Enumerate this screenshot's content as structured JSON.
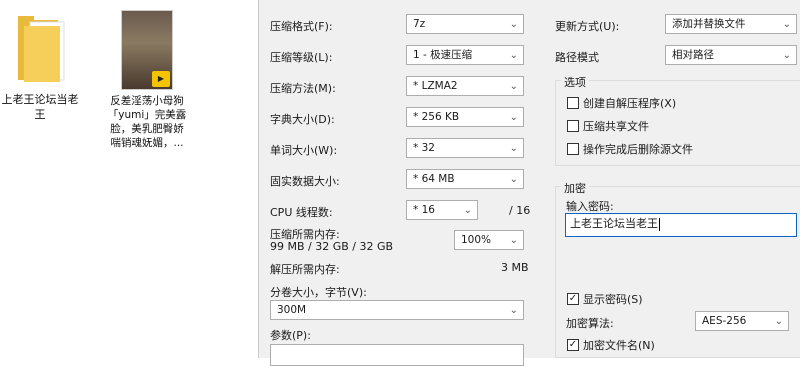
{
  "desktop": {
    "folder_label": "上老王论坛当老\n王",
    "video_label": "反差淫荡小母狗\n「yumi」完美露\n脸，美乳肥臀娇\n喘销魂妩媚，...",
    "video_badge": "Player"
  },
  "left": {
    "format_label": "压缩格式(F):",
    "format_value": "7z",
    "level_label": "压缩等级(L):",
    "level_value": "1 - 极速压缩",
    "method_label": "压缩方法(M):",
    "method_value": "* LZMA2",
    "dict_label": "字典大小(D):",
    "dict_value": "* 256 KB",
    "word_label": "单词大小(W):",
    "word_value": "* 32",
    "solid_label": "固实数据大小:",
    "solid_value": "* 64 MB",
    "cpu_label": "CPU 线程数:",
    "cpu_value": "* 16",
    "cpu_total": "/ 16",
    "mem_comp_label": "压缩所需内存:",
    "mem_comp_value": "99 MB / 32 GB / 32 GB",
    "mem_percent": "100%",
    "mem_decomp_label": "解压所需内存:",
    "mem_decomp_value": "3 MB",
    "split_label": "分卷大小，字节(V):",
    "split_value": "300M",
    "params_label": "参数(P):",
    "params_value": ""
  },
  "right": {
    "update_label": "更新方式(U):",
    "update_value": "添加并替换文件",
    "path_label": "路径模式",
    "path_value": "相对路径",
    "options_title": "选项",
    "opt_sfx": "创建自解压程序(X)",
    "opt_sfx_checked": false,
    "opt_shared": "压缩共享文件",
    "opt_shared_checked": false,
    "opt_delete": "操作完成后删除源文件",
    "opt_delete_checked": false,
    "encrypt_title": "加密",
    "password_label": "输入密码:",
    "password_value": "上老王论坛当老王",
    "show_password": "显示密码(S)",
    "show_password_checked": true,
    "enc_method_label": "加密算法:",
    "enc_method_value": "AES-256",
    "encrypt_names": "加密文件名(N)",
    "encrypt_names_checked": true
  },
  "colors": {
    "folder": "#f3c64a",
    "dialog_bg": "#f0f0f0",
    "password_border": "#0a64c8"
  }
}
